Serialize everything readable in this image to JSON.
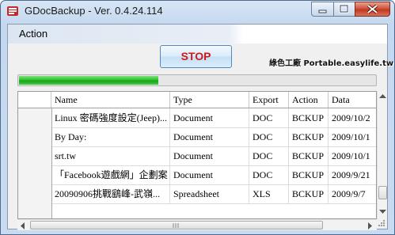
{
  "window": {
    "title": "GDocBackup - Ver. 0.4.24.114"
  },
  "menu": {
    "items": [
      "Action"
    ]
  },
  "toolbar": {
    "stop_label": "STOP"
  },
  "watermark": {
    "text": "綠色工廠 Portable.easylife.tw"
  },
  "progress": {
    "fraction": 0.39
  },
  "table": {
    "columns": [
      "Name",
      "Type",
      "Export",
      "Action",
      "Data"
    ],
    "rows": [
      [
        "Linux 密碼強度設定(Jeep)...",
        "Document",
        "DOC",
        "BCKUP",
        "2009/10/2"
      ],
      [
        "By Day:",
        "Document",
        "DOC",
        "BCKUP",
        "2009/10/1"
      ],
      [
        "srt.tw",
        "Document",
        "DOC",
        "BCKUP",
        "2009/10/1"
      ],
      [
        "「Facebook遊戲網」企劃案",
        "Document",
        "DOC",
        "BCKUP",
        "2009/9/21"
      ],
      [
        "20090906挑戰鷂峰-武嶺...",
        "Spreadsheet",
        "XLS",
        "BCKUP",
        "2009/9/7"
      ]
    ]
  },
  "colors": {
    "stop_text": "#d01818",
    "progress_green": "#22b522",
    "close_red": "#c0381f"
  }
}
